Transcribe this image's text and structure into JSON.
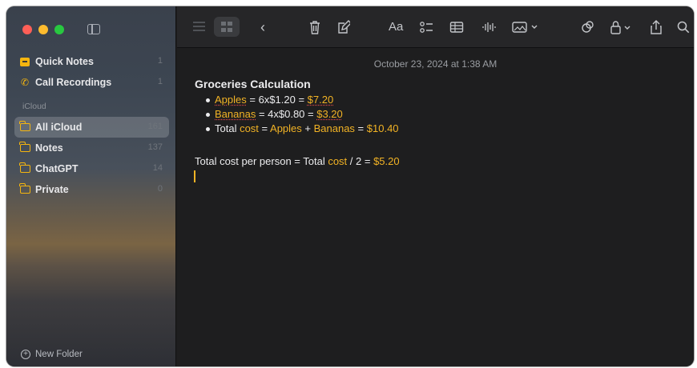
{
  "sidebar": {
    "pinned": [
      {
        "label": "Quick Notes",
        "count": "1",
        "icon": "quick-notes-icon"
      },
      {
        "label": "Call Recordings",
        "count": "1",
        "icon": "phone-icon"
      }
    ],
    "section_label": "iCloud",
    "folders": [
      {
        "label": "All iCloud",
        "count": "161",
        "selected": true
      },
      {
        "label": "Notes",
        "count": "137"
      },
      {
        "label": "ChatGPT",
        "count": "14"
      },
      {
        "label": "Private",
        "count": "0"
      }
    ],
    "new_folder_label": "New Folder"
  },
  "toolbar": {
    "icons": [
      "list-view-icon",
      "gallery-view-icon",
      "back-icon",
      "trash-icon",
      "compose-icon",
      "format-text-icon",
      "checklist-icon",
      "table-icon",
      "audio-icon",
      "media-icon",
      "collaborate-icon",
      "lock-icon",
      "share-icon",
      "search-icon"
    ],
    "format_label": "Aa"
  },
  "note": {
    "date": "October 23, 2024 at 1:38 AM",
    "title": "Groceries Calculation",
    "items": [
      {
        "name": "Apples",
        "expr": " = 6x$1.20 = ",
        "result": "$7.20"
      },
      {
        "name": "Bananas",
        "expr": " = 4x$0.80 = ",
        "result": "$3.20"
      },
      {
        "prefix": "Total ",
        "var1": "cost",
        "eq": " = ",
        "var2": "Apples",
        "plus": " + ",
        "var3": "Bananas",
        "eq2": " = ",
        "result": "$10.40"
      }
    ],
    "per_person": {
      "prefix": "Total cost per person = Total ",
      "var": "cost",
      "expr": " / 2 = ",
      "result": "$5.20"
    }
  },
  "colors": {
    "accent": "#f2b325",
    "background": "#1e1e1f",
    "sidebar_top": "#3a414c"
  }
}
